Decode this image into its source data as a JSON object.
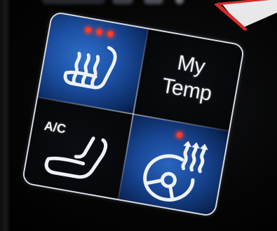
{
  "panel": {
    "heated_seat": {
      "icon": "heated-seat-icon",
      "level_indicators": 3,
      "active": true
    },
    "my_temp": {
      "line1": "My",
      "line2": "Temp",
      "active": false
    },
    "ventilated_seat": {
      "label": "A/C",
      "icon": "ventilated-seat-icon",
      "active": false
    },
    "heated_steering_wheel": {
      "icon": "heated-steering-wheel-icon",
      "level_indicators": 1,
      "active": true
    }
  },
  "colors": {
    "active_tile": "#1f55a8",
    "inactive_tile": "#07080b",
    "frame": "#d8dde4",
    "indicator": "#ff3b2a",
    "icon": "#eef1f5"
  }
}
